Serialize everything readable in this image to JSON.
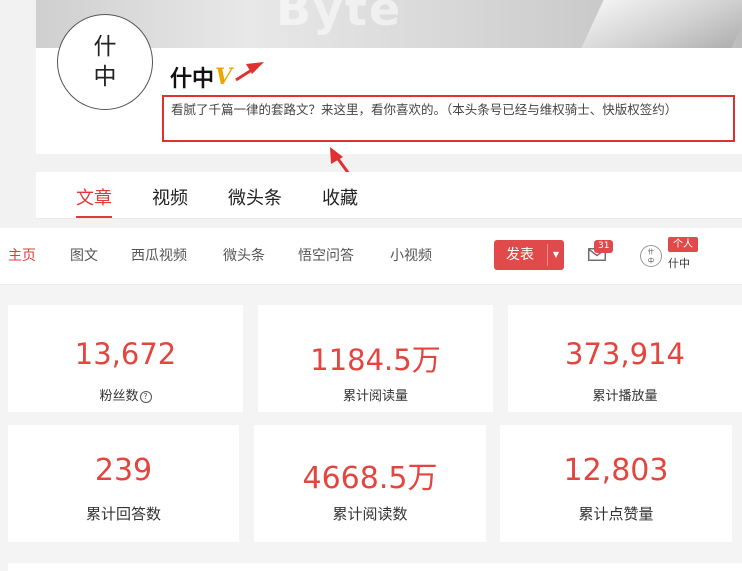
{
  "profile": {
    "banner_watermark": "Byte",
    "avatar_text": [
      "什",
      "中"
    ],
    "username": "什中",
    "verified_badge": "V",
    "bio": "看腻了千篇一律的套路文？来这里，看你喜欢的。（本头条号已经与维权骑士、快版权签约）"
  },
  "content_tabs": [
    {
      "label": "文章",
      "active": true
    },
    {
      "label": "视频",
      "active": false
    },
    {
      "label": "微头条",
      "active": false
    },
    {
      "label": "收藏",
      "active": false
    }
  ],
  "nav": {
    "items": [
      {
        "label": "主页",
        "active": true
      },
      {
        "label": "图文",
        "active": false
      },
      {
        "label": "西瓜视频",
        "active": false
      },
      {
        "label": "微头条",
        "active": false
      },
      {
        "label": "悟空问答",
        "active": false
      },
      {
        "label": "小视频",
        "active": false
      }
    ],
    "publish_label": "发表",
    "publish_caret": "▼",
    "mail_count": "31",
    "avatar_text": [
      "什",
      "中"
    ],
    "personal_tag": "个人",
    "username": "什中"
  },
  "stats": [
    {
      "value": "13,672",
      "label": "粉丝数",
      "help_icon": "?"
    },
    {
      "value": "1184.5万",
      "label": "累计阅读量"
    },
    {
      "value": "373,914",
      "label": "累计播放量"
    },
    {
      "value": "239",
      "label": "累计回答数"
    },
    {
      "value": "4668.5万",
      "label": "累计阅读数"
    },
    {
      "value": "12,803",
      "label": "累计点赞量"
    }
  ],
  "colors": {
    "accent": "#e03b3b",
    "stat_value": "#e2463f",
    "annotation": "#e03030",
    "badge_gold": "#f0a400"
  },
  "icons": {
    "mail": "mail-icon",
    "help": "question-circle-icon",
    "caret": "caret-down-icon"
  }
}
